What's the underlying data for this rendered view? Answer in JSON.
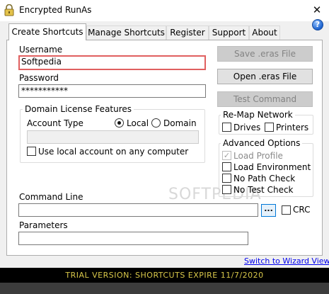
{
  "window": {
    "title": "Encrypted RunAs",
    "close_glyph": "✕"
  },
  "tabs": [
    {
      "label": "Create Shortcuts",
      "active": true
    },
    {
      "label": "Manage Shortcuts",
      "active": false
    },
    {
      "label": "Register",
      "active": false
    },
    {
      "label": "Support",
      "active": false
    },
    {
      "label": "About",
      "active": false
    }
  ],
  "help_glyph": "?",
  "form": {
    "username_label": "Username",
    "username_value": "Softpedia",
    "password_label": "Password",
    "password_value": "***********",
    "command_line_label": "Command Line",
    "command_line_value": "",
    "parameters_label": "Parameters",
    "parameters_value": "",
    "browse_label": "...",
    "crc_label": "CRC"
  },
  "domain_group": {
    "legend": "Domain License Features",
    "account_type_label": "Account Type",
    "radio_local": "Local",
    "radio_domain": "Domain",
    "selected": "Local",
    "domain_value": "",
    "use_local_label": "Use local account on any computer"
  },
  "buttons": {
    "save": "Save .eras File",
    "open": "Open .eras File",
    "test": "Test Command"
  },
  "remap_group": {
    "legend": "Re-Map Network",
    "drives": "Drives",
    "printers": "Printers"
  },
  "advanced_group": {
    "legend": "Advanced Options",
    "load_profile": "Load Profile",
    "load_environment": "Load Environment",
    "no_path_check": "No Path Check",
    "no_test_check": "No Test Check"
  },
  "wizard_link": "Switch to Wizard View",
  "watermark": "SOFTPEDIA",
  "status": "TRIAL VERSION: SHORTCUTS EXPIRE 11/7/2020",
  "colors": {
    "status_bg": "#000000",
    "status_text": "#d8c74a",
    "link": "#0000ee",
    "focus_border": "#e06060"
  }
}
